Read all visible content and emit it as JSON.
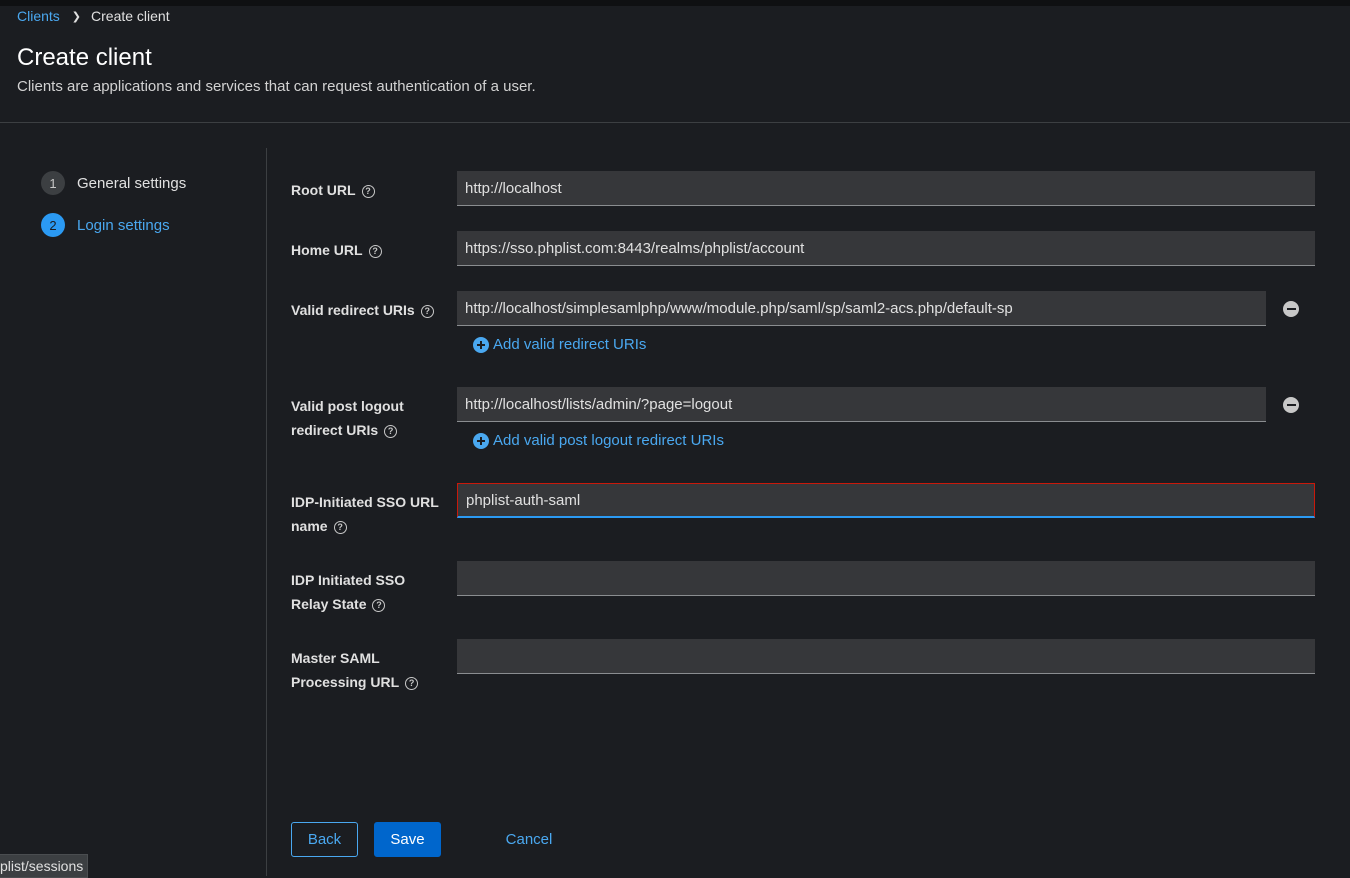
{
  "breadcrumb": {
    "link": "Clients",
    "current": "Create client"
  },
  "header": {
    "title": "Create client",
    "subtitle": "Clients are applications and services that can request authentication of a user."
  },
  "wizard": {
    "steps": [
      {
        "number": "1",
        "label": "General settings",
        "state": "inactive"
      },
      {
        "number": "2",
        "label": "Login settings",
        "state": "active"
      }
    ]
  },
  "form": {
    "root_url": {
      "label": "Root URL",
      "value": "http://localhost"
    },
    "home_url": {
      "label": "Home URL",
      "value": "https://sso.phplist.com:8443/realms/phplist/account"
    },
    "valid_redirect": {
      "label": "Valid redirect URIs",
      "value": "http://localhost/simplesamlphp/www/module.php/saml/sp/saml2-acs.php/default-sp",
      "add_label": "Add valid redirect URIs"
    },
    "valid_post_logout": {
      "label_line1": "Valid post logout",
      "label_line2": "redirect URIs",
      "value": "http://localhost/lists/admin/?page=logout",
      "add_label": "Add valid post logout redirect URIs"
    },
    "idp_sso_url_name": {
      "label_line1": "IDP-Initiated SSO URL",
      "label_line2": "name",
      "value": "phplist-auth-saml"
    },
    "idp_relay_state": {
      "label_line1": "IDP Initiated SSO",
      "label_line2": "Relay State",
      "value": ""
    },
    "master_saml": {
      "label_line1": "Master SAML",
      "label_line2": "Processing URL",
      "value": ""
    }
  },
  "actions": {
    "back": "Back",
    "save": "Save",
    "cancel": "Cancel"
  },
  "status_bar": {
    "url": "plist/sessions"
  },
  "colors": {
    "background": "#1b1d21",
    "accent": "#4aa8f0",
    "primary_button": "#0066cc",
    "input_background": "#36373a",
    "focus_error_border": "#c9190b"
  }
}
